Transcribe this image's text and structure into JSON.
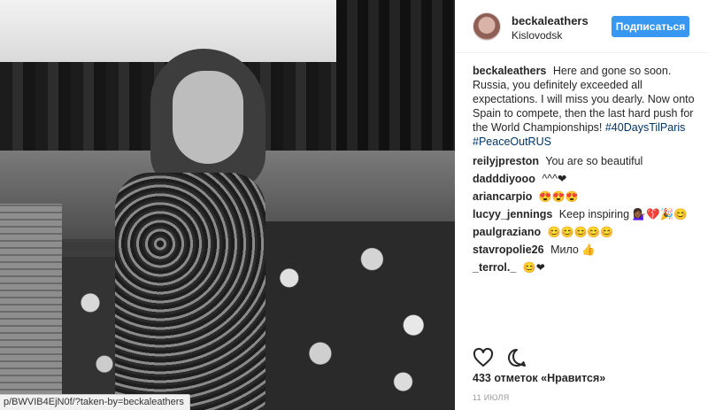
{
  "photo": {
    "url_fragment": "p/BWVIB4EjN0f/?taken-by=beckaleathers"
  },
  "header": {
    "username": "beckaleathers",
    "location": "Kislovodsk",
    "follow_label": "Подписаться"
  },
  "caption": {
    "user": "beckaleathers",
    "text": "Here and gone so soon. Russia, you definitely exceeded all expectations. I will miss you dearly. Now onto Spain to compete, then the last hard push for the World Championships!",
    "hashtag1": "#40DaysTilParis",
    "hashtag2": "#PeaceOutRUS"
  },
  "comments": [
    {
      "user": "reilyjpreston",
      "text": "You are so beautiful"
    },
    {
      "user": "dadddiyooo",
      "text": "^^^❤"
    },
    {
      "user": "ariancarpio",
      "text": "😍😍😍"
    },
    {
      "user": "lucyy_jennings",
      "text": "Keep inspiring 💁🏾‍♀️💔🎉😊"
    },
    {
      "user": "paulgraziano",
      "text": "😊😊😊😊😊"
    },
    {
      "user": "stavropolie26",
      "text": "Мило 👍"
    },
    {
      "user": "_terrol._",
      "text": "😊❤"
    }
  ],
  "footer": {
    "likes": "433 отметок «Нравится»",
    "date": "11 ИЮЛЯ"
  },
  "icons": {
    "like": "heart-icon",
    "comment": "comment-icon"
  }
}
